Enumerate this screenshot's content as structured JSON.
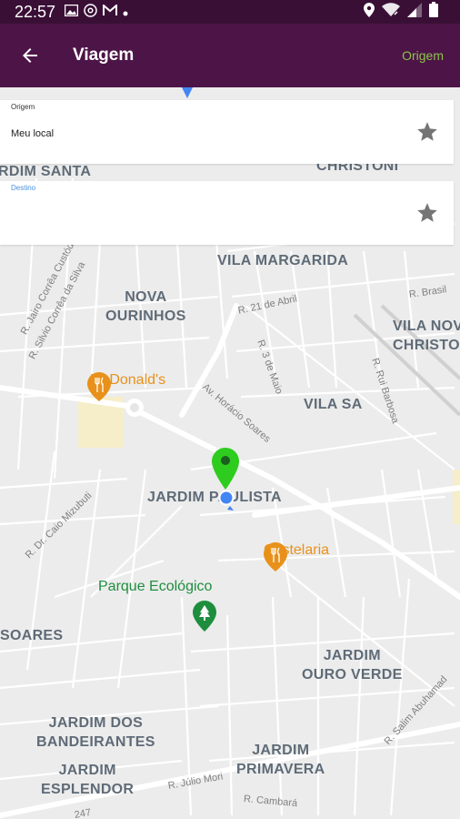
{
  "status_bar": {
    "time": "22:57",
    "icons": [
      "image-icon",
      "at-icon",
      "gmail-icon",
      "dot-icon"
    ],
    "right_icons": [
      "location-icon",
      "wifi-icon",
      "signal-icon",
      "battery-icon"
    ]
  },
  "app_bar": {
    "title": "Viagem",
    "action_label": "Origem",
    "action_color": "#8bc34a",
    "background": "#4d1447"
  },
  "origin_card": {
    "caption": "Origem",
    "value": "Meu local",
    "star_icon": "star-icon"
  },
  "destination_card": {
    "caption": "Destino",
    "caption_color": "#4a90d9",
    "value": "",
    "star_icon": "star-icon"
  },
  "map": {
    "neighborhoods": [
      "RDIM SANTA",
      "CHRISTONI",
      "VILA MARGARIDA",
      "NOVA\nOURINHOS",
      "VILA NOV\nCHRISTO",
      "VILA SA",
      "JARDIM PAULISTA",
      "SOARES",
      "JARDIM\nOURO VERDE",
      "JARDIM DOS\nBANDEIRANTES",
      "JARDIM\nESPLENDOR",
      "JARDIM\nPRIMAVERA"
    ],
    "streets": [
      "R. Jairo Corrêa Custódio",
      "R. Silvio Corrêa da Silva",
      "R. 21 de Abril",
      "R. Brasil",
      "R. 3 de Maio",
      "Av. Horácio Soares",
      "R. Rui Barbosa",
      "R. Dr. Caio Mizubuti",
      "R. Salim Abuhamad",
      "R. Júlio Mori",
      "R. Cambará",
      "247"
    ],
    "pois": {
      "mcdonalds": "McDonald's",
      "costelaria": "Costelaria",
      "parque": "Parque Ecológico"
    },
    "poi_colors": {
      "food": "#e8911a",
      "park": "#1e8e3e"
    },
    "marker_color": "#2ecc1f",
    "location_dot_color": "#4285f4"
  }
}
